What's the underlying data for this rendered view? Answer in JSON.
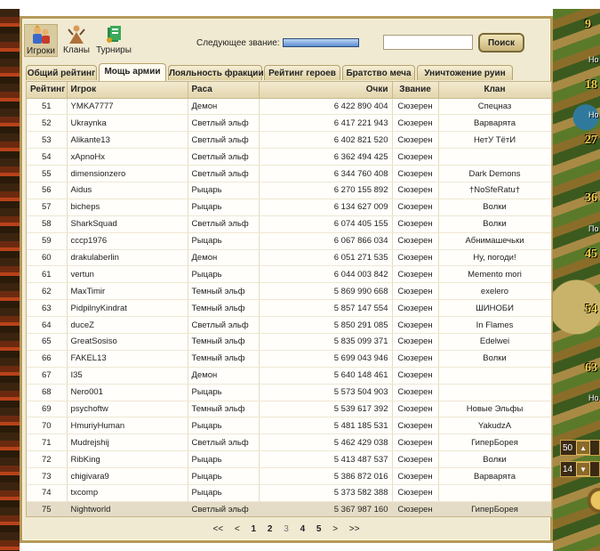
{
  "nav": {
    "players_label": "Игроки",
    "clans_label": "Кланы",
    "tournaments_label": "Турниры"
  },
  "next_rank": {
    "label": "Следующее звание:"
  },
  "search": {
    "value": "",
    "button_label": "Поиск"
  },
  "tabs": [
    {
      "label": "Общий рейтинг"
    },
    {
      "label": "Мощь армии"
    },
    {
      "label": "Лояльность фракции"
    },
    {
      "label": "Рейтинг героев"
    },
    {
      "label": "Братство меча"
    },
    {
      "label": "Уничтожение руин"
    }
  ],
  "columns": {
    "rank": "Рейтинг",
    "player": "Игрок",
    "race": "Раса",
    "points": "Очки",
    "title": "Звание",
    "clan": "Клан"
  },
  "rows": [
    {
      "rank": "51",
      "player": "YMKA7777",
      "race": "Демон",
      "points": "6 422 890 404",
      "title": "Сюзерен",
      "clan": "Спецназ"
    },
    {
      "rank": "52",
      "player": "Ukraynka",
      "race": "Светлый эльф",
      "points": "6 417 221 943",
      "title": "Сюзерен",
      "clan": "Варварята"
    },
    {
      "rank": "53",
      "player": "Alikante13",
      "race": "Светлый эльф",
      "points": "6 402 821 520",
      "title": "Сюзерен",
      "clan": "НетУ ТётИ"
    },
    {
      "rank": "54",
      "player": "xApnoHx",
      "race": "Светлый эльф",
      "points": "6 362 494 425",
      "title": "Сюзерен",
      "clan": ""
    },
    {
      "rank": "55",
      "player": "dimensionzero",
      "race": "Светлый эльф",
      "points": "6 344 760 408",
      "title": "Сюзерен",
      "clan": "Dark Demons"
    },
    {
      "rank": "56",
      "player": "Aidus",
      "race": "Рыцарь",
      "points": "6 270 155 892",
      "title": "Сюзерен",
      "clan": "†NoSfeRatu†"
    },
    {
      "rank": "57",
      "player": "bicheps",
      "race": "Рыцарь",
      "points": "6 134 627 009",
      "title": "Сюзерен",
      "clan": "Волки"
    },
    {
      "rank": "58",
      "player": "SharkSquad",
      "race": "Светлый эльф",
      "points": "6 074 405 155",
      "title": "Сюзерен",
      "clan": "Волки"
    },
    {
      "rank": "59",
      "player": "cccp1976",
      "race": "Рыцарь",
      "points": "6 067 866 034",
      "title": "Сюзерен",
      "clan": "Абнимашечьки"
    },
    {
      "rank": "60",
      "player": "drakulaberlin",
      "race": "Демон",
      "points": "6 051 271 535",
      "title": "Сюзерен",
      "clan": "Ну, погоди!"
    },
    {
      "rank": "61",
      "player": "vertun",
      "race": "Рыцарь",
      "points": "6 044 003 842",
      "title": "Сюзерен",
      "clan": "Memento mori"
    },
    {
      "rank": "62",
      "player": "MaxTimir",
      "race": "Темный эльф",
      "points": "5 869 990 668",
      "title": "Сюзерен",
      "clan": "exelero"
    },
    {
      "rank": "63",
      "player": "PidpilnyKindrat",
      "race": "Темный эльф",
      "points": "5 857 147 554",
      "title": "Сюзерен",
      "clan": "ШИНОБИ"
    },
    {
      "rank": "64",
      "player": "duceZ",
      "race": "Светлый эльф",
      "points": "5 850 291 085",
      "title": "Сюзерен",
      "clan": "In Flames"
    },
    {
      "rank": "65",
      "player": "GreatSosiso",
      "race": "Темный эльф",
      "points": "5 835 099 371",
      "title": "Сюзерен",
      "clan": "Edelwei"
    },
    {
      "rank": "66",
      "player": "FAKEL13",
      "race": "Темный эльф",
      "points": "5 699 043 946",
      "title": "Сюзерен",
      "clan": "Волки"
    },
    {
      "rank": "67",
      "player": "I35",
      "race": "Демон",
      "points": "5 640 148 461",
      "title": "Сюзерен",
      "clan": ""
    },
    {
      "rank": "68",
      "player": "Nero001",
      "race": "Рыцарь",
      "points": "5 573 504 903",
      "title": "Сюзерен",
      "clan": ""
    },
    {
      "rank": "69",
      "player": "psychoftw",
      "race": "Темный эльф",
      "points": "5 539 617 392",
      "title": "Сюзерен",
      "clan": "Новые Эльфы"
    },
    {
      "rank": "70",
      "player": "HmuriyHuman",
      "race": "Рыцарь",
      "points": "5 481 185 531",
      "title": "Сюзерен",
      "clan": "YakudzA"
    },
    {
      "rank": "71",
      "player": "Mudrejshij",
      "race": "Светлый эльф",
      "points": "5 462 429 038",
      "title": "Сюзерен",
      "clan": "ГиперБорея"
    },
    {
      "rank": "72",
      "player": "RibKing",
      "race": "Рыцарь",
      "points": "5 413 487 537",
      "title": "Сюзерен",
      "clan": "Волки"
    },
    {
      "rank": "73",
      "player": "chigivara9",
      "race": "Рыцарь",
      "points": "5 386 872 016",
      "title": "Сюзерен",
      "clan": "Варварята"
    },
    {
      "rank": "74",
      "player": "txcomp",
      "race": "Рыцарь",
      "points": "5 373 582 388",
      "title": "Сюзерен",
      "clan": ""
    },
    {
      "rank": "75",
      "player": "Nightworld",
      "race": "Светлый эльф",
      "points": "5 367 987 160",
      "title": "Сюзерен",
      "clan": "ГиперБорея"
    }
  ],
  "pager": {
    "first": "<<",
    "prev": "<",
    "pages": [
      "1",
      "2",
      "3",
      "4",
      "5"
    ],
    "current": "3",
    "next": ">",
    "last": ">>"
  },
  "map": {
    "numbers": [
      "9",
      "18",
      "27",
      "36",
      "45",
      "54",
      "63"
    ],
    "labels": [
      "Но",
      "Но",
      "По",
      "Но"
    ],
    "widget_values": [
      "50",
      "14"
    ]
  },
  "colors": {
    "panel_bg": "#f1ead2",
    "panel_border": "#b59a5a",
    "rank_bar": "#6f9fd4",
    "highlight_row": "#e4dcc6"
  }
}
